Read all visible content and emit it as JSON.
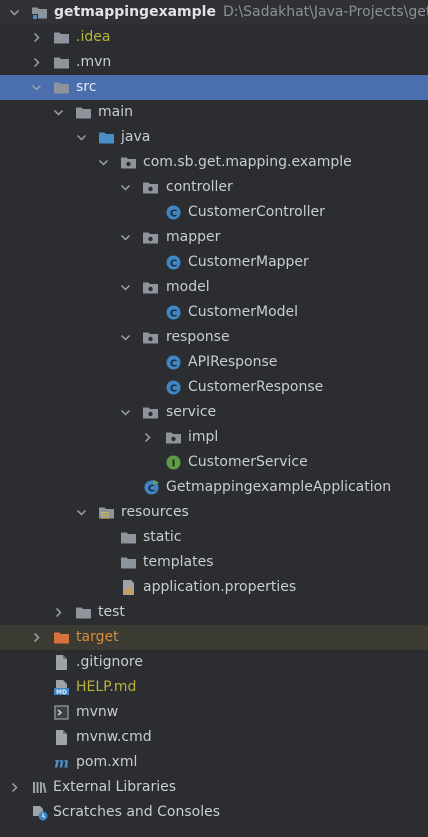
{
  "project": {
    "name": "getmappingexample",
    "path": "D:\\Sadakhat\\Java-Projects\\getmap"
  },
  "tree": {
    "idea": ".idea",
    "mvn": ".mvn",
    "src": "src",
    "main": "main",
    "java": "java",
    "package": "com.sb.get.mapping.example",
    "controller": "controller",
    "customer_controller": "CustomerController",
    "mapper": "mapper",
    "customer_mapper": "CustomerMapper",
    "model": "model",
    "customer_model": "CustomerModel",
    "response": "response",
    "api_response": "APIResponse",
    "customer_response": "CustomerResponse",
    "service": "service",
    "impl": "impl",
    "customer_service": "CustomerService",
    "application": "GetmappingexampleApplication",
    "resources": "resources",
    "static": "static",
    "templates": "templates",
    "application_properties": "application.properties",
    "test": "test",
    "target": "target",
    "gitignore": ".gitignore",
    "help_md": "HELP.md",
    "mvnw": "mvnw",
    "mvnw_cmd": "mvnw.cmd",
    "pom_xml": "pom.xml",
    "external_libraries": "External Libraries",
    "scratches": "Scratches and Consoles"
  },
  "icon_badges": {
    "class": "C",
    "interface": "I",
    "markdown": "MD",
    "maven": "m"
  },
  "colors": {
    "background": "#2b2d30",
    "selection": "#4b6eaf",
    "excluded_highlight": "#3b3b34",
    "folder": "#8e949c",
    "source_folder": "#4a8fc9",
    "excluded_folder": "#d6733d",
    "class_icon": "#3f86c7",
    "interface_icon": "#5f9c45",
    "text": "#c8ccd3",
    "ignored_text": "#b8b23d",
    "excluded_text": "#d68b3e"
  }
}
